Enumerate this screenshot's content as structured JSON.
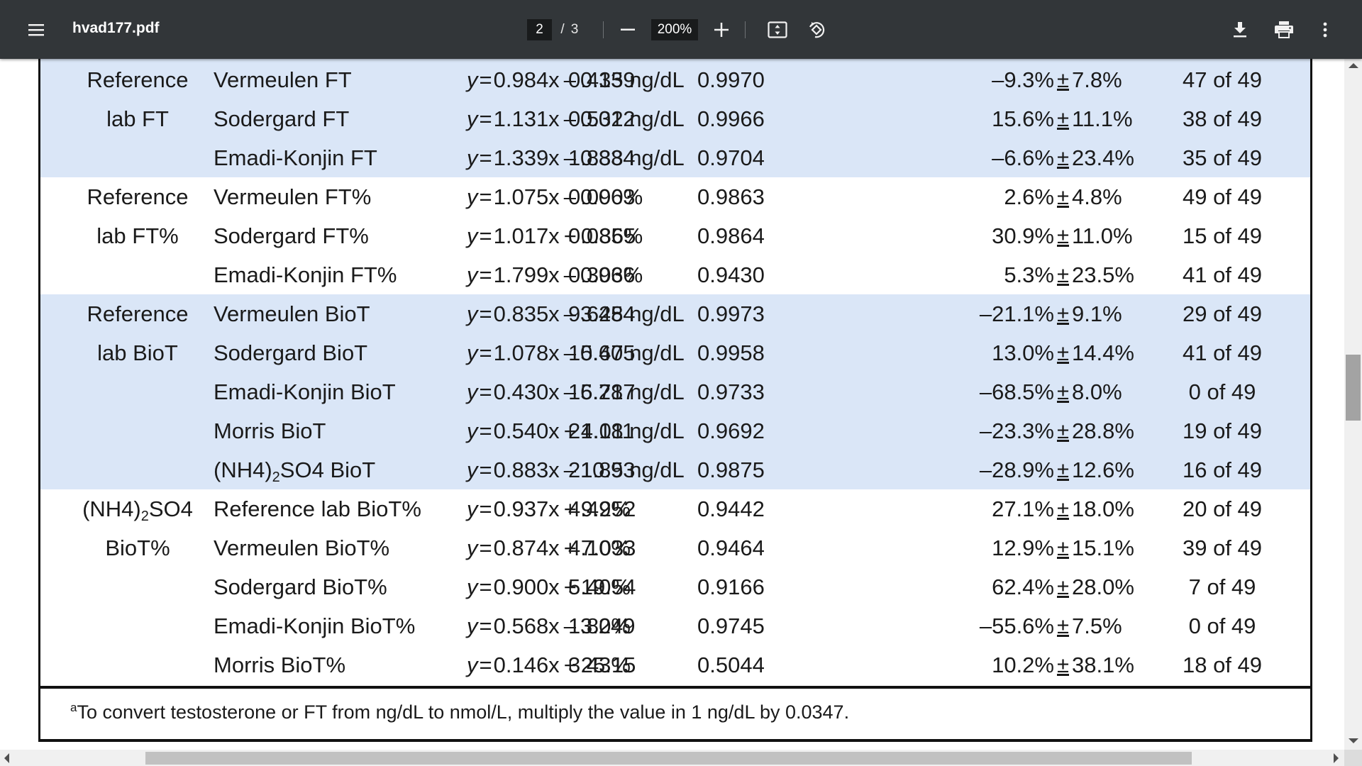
{
  "toolbar": {
    "title": "hvad177.pdf",
    "current_page": "2",
    "page_separator": "/",
    "total_pages": "3",
    "zoom": "200%",
    "icons": {
      "menu": "hamburger-menu-icon",
      "zoom_out": "minus-icon",
      "zoom_in": "plus-icon",
      "fit": "fit-to-page-icon",
      "rotate": "rotate-counterclockwise-icon",
      "download": "download-icon",
      "print": "print-icon",
      "more": "more-vertical-icon"
    }
  },
  "table": {
    "groups": [
      {
        "label_line1": "Reference",
        "label_line2": "lab FT",
        "shaded": true,
        "rows": [
          {
            "method": "Vermeulen FT",
            "eq_coef": "0.984x",
            "eq_op": "–",
            "eq_const": "0.139",
            "error": "0.435 ng/dL",
            "r": "0.9970",
            "bias_mean": "–9.3%",
            "bias_sd": "7.8%",
            "agreement": "47 of 49"
          },
          {
            "method": "Sodergard FT",
            "eq_coef": "1.131x",
            "eq_op": "–",
            "eq_const": "0.012",
            "error": "0.532 ng/dL",
            "r": "0.9966",
            "bias_mean": "15.6%",
            "bias_sd": "11.1%",
            "agreement": "38 of 49"
          },
          {
            "method": "Emadi-Konjin FT",
            "eq_coef": "1.339x",
            "eq_op": "–",
            "eq_const": "0.834",
            "error": "1.838 ng/dL",
            "r": "0.9704",
            "bias_mean": "–6.6%",
            "bias_sd": "23.4%",
            "agreement": "35 of 49"
          }
        ]
      },
      {
        "label_line1": "Reference",
        "label_line2": "lab FT%",
        "shaded": false,
        "rows": [
          {
            "method": "Vermeulen FT%",
            "eq_coef": "1.075x",
            "eq_op": "–",
            "eq_const": "0.063",
            "error": "0.090%",
            "r": "0.9863",
            "bias_mean": "2.6%",
            "bias_sd": "4.8%",
            "agreement": "49 of 49"
          },
          {
            "method": "Sodergard FT%",
            "eq_coef": "1.017x",
            "eq_op": "+",
            "eq_const": "0.365",
            "error": "0.085%",
            "r": "0.9864",
            "bias_mean": "30.9%",
            "bias_sd": "11.0%",
            "agreement": "15 of 49"
          },
          {
            "method": "Emadi-Konjin FT%",
            "eq_coef": "1.799x",
            "eq_op": "–",
            "eq_const": "0.966",
            "error": "0.303%",
            "r": "0.9430",
            "bias_mean": "5.3%",
            "bias_sd": "23.5%",
            "agreement": "41 of 49"
          }
        ]
      },
      {
        "label_line1": "Reference",
        "label_line2": "lab BioT",
        "shaded": true,
        "rows": [
          {
            "method": "Vermeulen BioT",
            "eq_coef": "0.835x",
            "eq_op": "–",
            "eq_const": "3.454",
            "error": "9.628 ng/dL",
            "r": "0.9973",
            "bias_mean": "–21.1%",
            "bias_sd": "9.1%",
            "agreement": "29 of 49"
          },
          {
            "method": "Sodergard BioT",
            "eq_coef": "1.078x",
            "eq_op": "–",
            "eq_const": "0.605",
            "error": "15.47 ng/dL",
            "r": "0.9958",
            "bias_mean": "13.0%",
            "bias_sd": "14.4%",
            "agreement": "41 of 49"
          },
          {
            "method": "Emadi-Konjin BioT",
            "eq_coef": "0.430x",
            "eq_op": "–",
            "eq_const": "6.287",
            "error": "15.71 ng/dL",
            "r": "0.9733",
            "bias_mean": "–68.5%",
            "bias_sd": "8.0%",
            "agreement": "0 of 49"
          },
          {
            "method": "Morris BioT",
            "eq_coef": "0.540x",
            "eq_op": "+",
            "eq_const": "4.011",
            "error": "21.18 ng/dL",
            "r": "0.9692",
            "bias_mean": "–23.3%",
            "bias_sd": "28.8%",
            "agreement": "19 of 49"
          },
          {
            "method_pre": "(NH4)",
            "method_sub": "2",
            "method_post": "SO4 BioT",
            "eq_coef": "0.883x",
            "eq_op": "–",
            "eq_const": "10.93",
            "error": "21.85 ng/dL",
            "r": "0.9875",
            "bias_mean": "–28.9%",
            "bias_sd": "12.6%",
            "agreement": "16 of 49"
          }
        ]
      },
      {
        "label_line1_pre": "(NH4)",
        "label_line1_sub": "2",
        "label_line1_post": "SO4",
        "label_line2": "BioT%",
        "shaded": false,
        "rows": [
          {
            "method": "Reference lab BioT%",
            "eq_coef": "0.937x",
            "eq_op": "+",
            "eq_const": "9.252",
            "error": "4.49%",
            "r": "0.9442",
            "bias_mean": "27.1%",
            "bias_sd": "18.0%",
            "agreement": "20 of 49"
          },
          {
            "method": "Vermeulen BioT%",
            "eq_coef": "0.874x",
            "eq_op": "+",
            "eq_const": "7.033",
            "error": "4.10%",
            "r": "0.9464",
            "bias_mean": "12.9%",
            "bias_sd": "15.1%",
            "agreement": "39 of 49"
          },
          {
            "method": "Sodergard BioT%",
            "eq_coef": "0.900x",
            "eq_op": "+",
            "eq_const": "19.54",
            "error": "5.40%",
            "r": "0.9166",
            "bias_mean": "62.4%",
            "bias_sd": "28.0%",
            "agreement": "7 of 49"
          },
          {
            "method": "Emadi-Konjin BioT%",
            "eq_coef": "0.568x",
            "eq_op": "–",
            "eq_const": "3.249",
            "error": "1.80%",
            "r": "0.9745",
            "bias_mean": "–55.6%",
            "bias_sd": "7.5%",
            "agreement": "0 of 49"
          },
          {
            "method": "Morris BioT%",
            "eq_coef": "0.146x",
            "eq_op": "+",
            "eq_const": "25.15",
            "error": "3.43%",
            "r": "0.5044",
            "bias_mean": "10.2%",
            "bias_sd": "38.1%",
            "agreement": "18 of 49"
          }
        ]
      }
    ],
    "eq_prefix": "y",
    "eq_equals": "=",
    "pm_symbol": "±",
    "shade_color": "#dae6f7",
    "footnote_marker": "a",
    "footnote_text": "To convert testosterone or FT from ng/dL to nmol/L, multiply the value in 1 ng/dL by 0.0347."
  }
}
